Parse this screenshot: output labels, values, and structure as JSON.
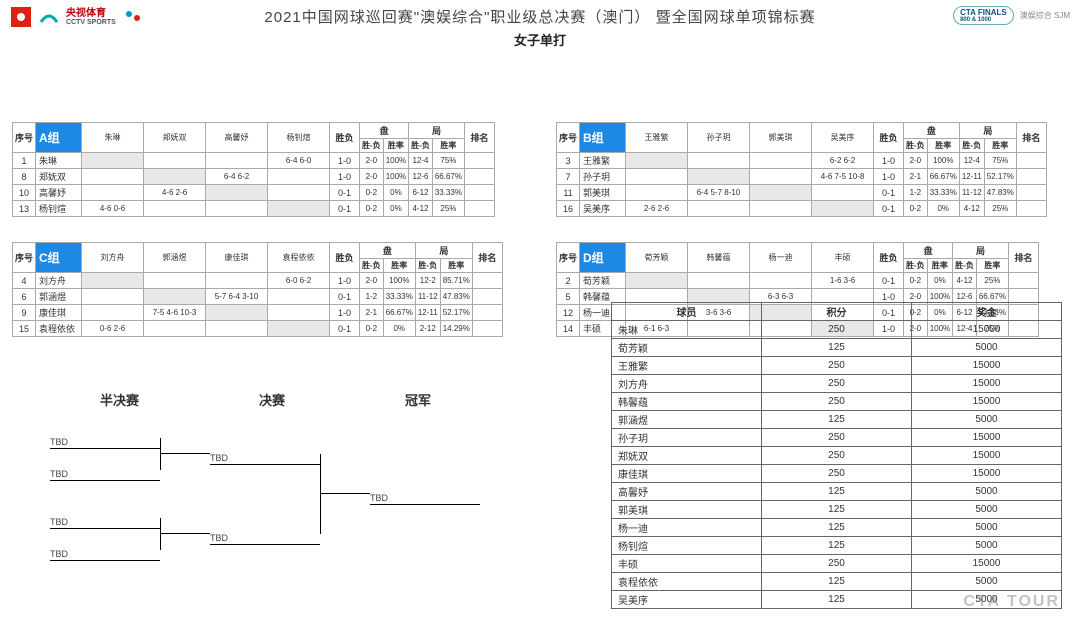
{
  "header": {
    "title": "2021中国网球巡回赛\"澳娱综合\"职业级总决赛（澳门） 暨全国网球单项锦标赛",
    "subtitle": "女子单打",
    "cctv_top": "央视体育",
    "cctv_bottom": "CCTV SPORTS",
    "finals": "CTA FINALS",
    "finals_sub": "800 & 1000",
    "sjm": "澳娱综合 SJM"
  },
  "columns": {
    "seed": "序号",
    "wl": "胜负",
    "set": "盘",
    "game": "局",
    "rank": "排名",
    "wlsub": "胜-负",
    "ratesub": "胜率"
  },
  "groups": [
    {
      "name": "A组",
      "players": [
        "朱琳",
        "郑妩双",
        "高馨妤",
        "杨钊煊"
      ],
      "seeds": [
        "1",
        "8",
        "10",
        "13"
      ],
      "cells": [
        [
          "",
          "",
          "",
          "6-4 6-0"
        ],
        [
          "",
          "",
          "6-4 6-2",
          ""
        ],
        [
          "",
          "4-6 2-6",
          "",
          ""
        ],
        [
          "4-6 0-6",
          "",
          "",
          ""
        ]
      ],
      "wl": [
        "1-0",
        "1-0",
        "0-1",
        "0-1"
      ],
      "set_wl": [
        "2-0",
        "2-0",
        "0-2",
        "0-2"
      ],
      "set_rate": [
        "100%",
        "100%",
        "0%",
        "0%"
      ],
      "game_wl": [
        "12-4",
        "12-6",
        "6-12",
        "4-12"
      ],
      "game_rate": [
        "75%",
        "66.67%",
        "33.33%",
        "25%"
      ]
    },
    {
      "name": "B组",
      "players": [
        "王雅繁",
        "孙子玥",
        "郭美琪",
        "吴美序"
      ],
      "seeds": [
        "3",
        "7",
        "11",
        "16"
      ],
      "cells": [
        [
          "",
          "",
          "",
          "6-2 6-2"
        ],
        [
          "",
          "",
          "",
          "4-6 7-5 10-8"
        ],
        [
          "",
          "6-4 5-7 8-10",
          "",
          ""
        ],
        [
          "2-6 2-6",
          "",
          "",
          ""
        ]
      ],
      "wl": [
        "1-0",
        "1-0",
        "0-1",
        "0-1"
      ],
      "set_wl": [
        "2-0",
        "2-1",
        "1-2",
        "0-2"
      ],
      "set_rate": [
        "100%",
        "66.67%",
        "33.33%",
        "0%"
      ],
      "game_wl": [
        "12-4",
        "12-11",
        "11-12",
        "4-12"
      ],
      "game_rate": [
        "75%",
        "52.17%",
        "47.83%",
        "25%"
      ]
    },
    {
      "name": "C组",
      "players": [
        "刘方舟",
        "郭涵煜",
        "康佳琪",
        "袁程依依"
      ],
      "seeds": [
        "4",
        "6",
        "9",
        "15"
      ],
      "cells": [
        [
          "",
          "",
          "",
          "6-0 6-2"
        ],
        [
          "",
          "",
          "5-7 6-4  3-10",
          ""
        ],
        [
          "",
          "7-5 4-6  10-3",
          "",
          ""
        ],
        [
          "0-6 2-6",
          "",
          "",
          ""
        ]
      ],
      "wl": [
        "1-0",
        "0-1",
        "1-0",
        "0-1"
      ],
      "set_wl": [
        "2-0",
        "1-2",
        "2-1",
        "0-2"
      ],
      "set_rate": [
        "100%",
        "33.33%",
        "66.67%",
        "0%"
      ],
      "game_wl": [
        "12-2",
        "11-12",
        "12-11",
        "2-12"
      ],
      "game_rate": [
        "85.71%",
        "47.83%",
        "52.17%",
        "14.29%"
      ]
    },
    {
      "name": "D组",
      "players": [
        "荀芳颖",
        "韩馨蕴",
        "杨一迪",
        "丰硕"
      ],
      "seeds": [
        "2",
        "5",
        "12",
        "14"
      ],
      "cells": [
        [
          "",
          "",
          "",
          "1-6 3-6"
        ],
        [
          "",
          "",
          "6-3 6-3",
          ""
        ],
        [
          "",
          "3-6 3-6",
          "",
          ""
        ],
        [
          "6-1 6-3",
          "",
          "",
          ""
        ]
      ],
      "wl": [
        "0-1",
        "1-0",
        "0-1",
        "1-0"
      ],
      "set_wl": [
        "0-2",
        "2-0",
        "0-2",
        "2-0"
      ],
      "set_rate": [
        "0%",
        "100%",
        "0%",
        "100%"
      ],
      "game_wl": [
        "4-12",
        "12-6",
        "6-12",
        "12-4"
      ],
      "game_rate": [
        "25%",
        "66.67%",
        "33.33%",
        "75%"
      ]
    }
  ],
  "bracket": {
    "labels": {
      "sf": "半决赛",
      "f": "决赛",
      "champ": "冠军"
    },
    "tbd": "TBD"
  },
  "points": {
    "headers": {
      "player": "球员",
      "points": "积分",
      "prize": "奖金"
    },
    "rows": [
      {
        "name": "朱琳",
        "pts": "250",
        "prize": "15000"
      },
      {
        "name": "荀芳颖",
        "pts": "125",
        "prize": "5000"
      },
      {
        "name": "王雅繁",
        "pts": "250",
        "prize": "15000"
      },
      {
        "name": "刘方舟",
        "pts": "250",
        "prize": "15000"
      },
      {
        "name": "韩馨蕴",
        "pts": "250",
        "prize": "15000"
      },
      {
        "name": "郭涵煜",
        "pts": "125",
        "prize": "5000"
      },
      {
        "name": "孙子玥",
        "pts": "250",
        "prize": "15000"
      },
      {
        "name": "郑妩双",
        "pts": "250",
        "prize": "15000"
      },
      {
        "name": "康佳琪",
        "pts": "250",
        "prize": "15000"
      },
      {
        "name": "高馨妤",
        "pts": "125",
        "prize": "5000"
      },
      {
        "name": "郭美琪",
        "pts": "125",
        "prize": "5000"
      },
      {
        "name": "杨一迪",
        "pts": "125",
        "prize": "5000"
      },
      {
        "name": "杨钊煊",
        "pts": "125",
        "prize": "5000"
      },
      {
        "name": "丰硕",
        "pts": "250",
        "prize": "15000"
      },
      {
        "name": "袁程依依",
        "pts": "125",
        "prize": "5000"
      },
      {
        "name": "吴美序",
        "pts": "125",
        "prize": "5000"
      }
    ]
  },
  "watermark": "CTA  TOUR"
}
